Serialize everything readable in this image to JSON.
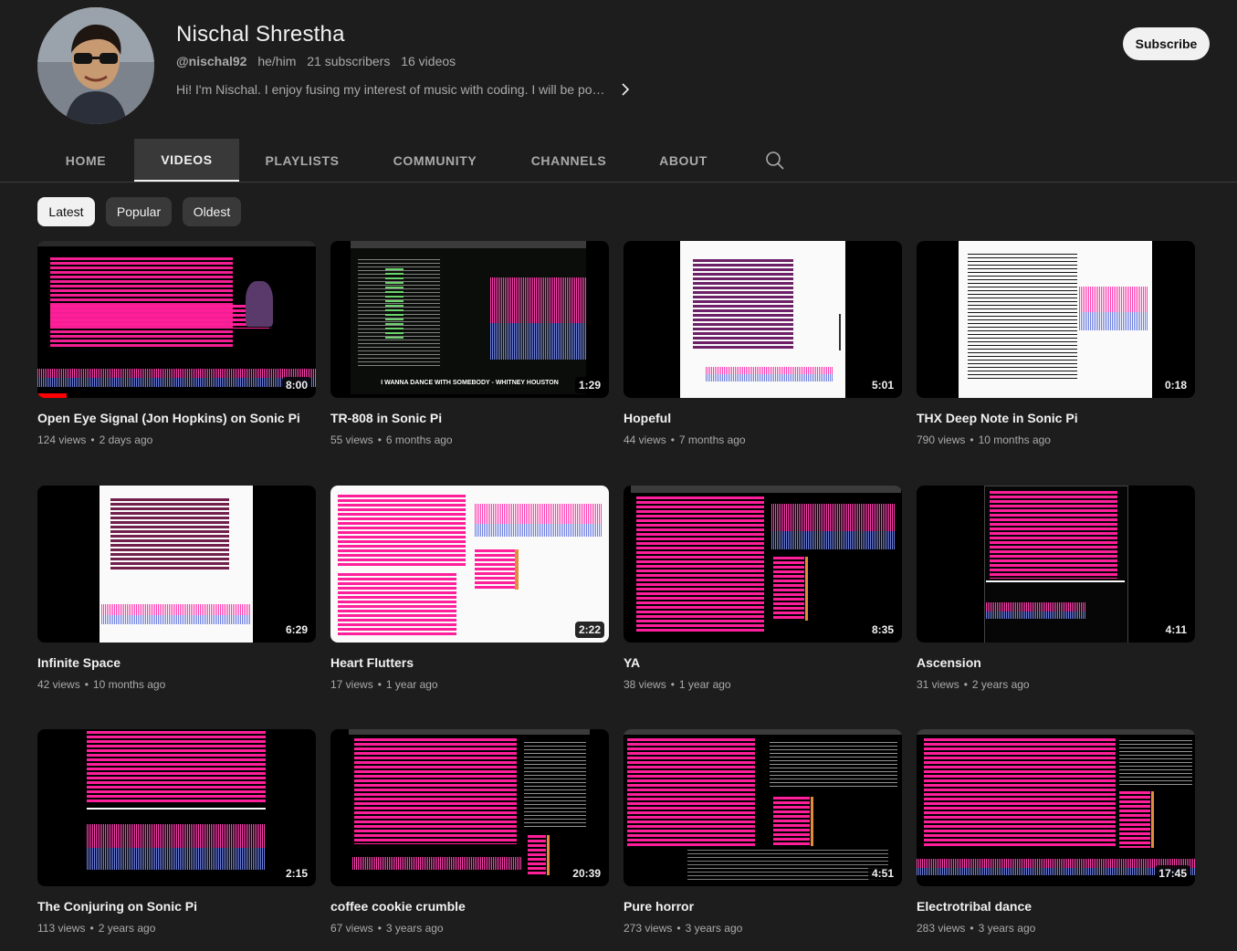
{
  "channel": {
    "name": "Nischal Shrestha",
    "handle": "@nischal92",
    "pronouns": "he/him",
    "subscribers": "21 subscribers",
    "video_count": "16 videos",
    "about": "Hi! I'm Nischal. I enjoy fusing my interest of music with coding. I will be po…",
    "subscribe_label": "Subscribe"
  },
  "tabs": [
    {
      "label": "HOME"
    },
    {
      "label": "VIDEOS",
      "active": true
    },
    {
      "label": "PLAYLISTS"
    },
    {
      "label": "COMMUNITY"
    },
    {
      "label": "CHANNELS"
    },
    {
      "label": "ABOUT"
    }
  ],
  "icons": {
    "search": "search-icon",
    "chevron": "chevron-right-icon"
  },
  "chips": [
    {
      "label": "Latest",
      "active": true
    },
    {
      "label": "Popular"
    },
    {
      "label": "Oldest"
    }
  ],
  "thumbnail_caption": "I WANNA DANCE WITH SOMEBODY - WHITNEY HOUSTON",
  "videos": [
    {
      "title": "Open Eye Signal (Jon Hopkins) on Sonic Pi",
      "views": "124 views",
      "age": "2 days ago",
      "duration": "8:00"
    },
    {
      "title": "TR-808 in Sonic Pi",
      "views": "55 views",
      "age": "6 months ago",
      "duration": "1:29"
    },
    {
      "title": "Hopeful",
      "views": "44 views",
      "age": "7 months ago",
      "duration": "5:01"
    },
    {
      "title": "THX Deep Note in Sonic Pi",
      "views": "790 views",
      "age": "10 months ago",
      "duration": "0:18"
    },
    {
      "title": "Infinite Space",
      "views": "42 views",
      "age": "10 months ago",
      "duration": "6:29"
    },
    {
      "title": "Heart Flutters",
      "views": "17 views",
      "age": "1 year ago",
      "duration": "2:22"
    },
    {
      "title": "YA",
      "views": "38 views",
      "age": "1 year ago",
      "duration": "8:35"
    },
    {
      "title": "Ascension",
      "views": "31 views",
      "age": "2 years ago",
      "duration": "4:11"
    },
    {
      "title": "The Conjuring on Sonic Pi",
      "views": "113 views",
      "age": "2 years ago",
      "duration": "2:15"
    },
    {
      "title": "coffee cookie crumble",
      "views": "67 views",
      "age": "3 years ago",
      "duration": "20:39"
    },
    {
      "title": "Pure horror",
      "views": "273 views",
      "age": "3 years ago",
      "duration": "4:51"
    },
    {
      "title": "Electrotribal dance",
      "views": "283 views",
      "age": "3 years ago",
      "duration": "17:45"
    }
  ],
  "colors": {
    "background": "#1e1d1d",
    "code_pink": "#ff1f9a",
    "wave_blue": "#6d7fe0",
    "chip_bg": "#3a3939"
  }
}
